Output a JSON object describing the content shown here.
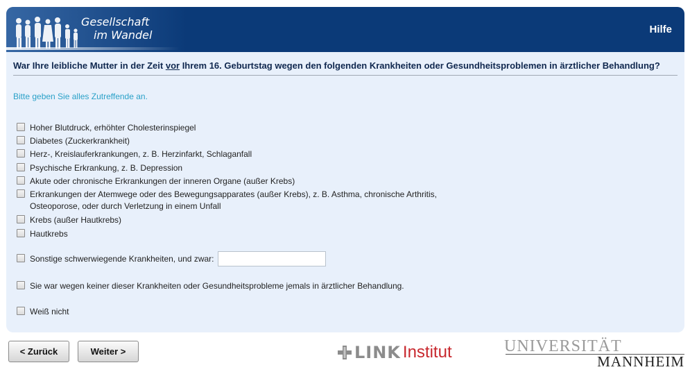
{
  "header": {
    "logo_line1": "Gesellschaft",
    "logo_line2": "im Wandel",
    "help_label": "Hilfe",
    "background_color": "#0b3a78"
  },
  "question": {
    "text_before": "War Ihre leibliche Mutter in der Zeit ",
    "text_underlined": "vor",
    "text_after": " Ihrem 16. Geburtstag wegen den folgenden Krankheiten oder Gesundheitsproblemen in ärztlicher Behandlung?",
    "instruction": "Bitte geben Sie alles Zutreffende an."
  },
  "options": [
    "Hoher Blutdruck, erhöhter Cholesterinspiegel",
    "Diabetes (Zuckerkrankheit)",
    "Herz-, Kreislauferkrankungen, z. B. Herzinfarkt, Schlaganfall",
    "Psychische Erkrankung, z. B. Depression",
    "Akute oder chronische Erkrankungen der inneren Organe (außer Krebs)",
    "Erkrankungen der Atemwege oder des Bewegungsapparates (außer Krebs), z. B. Asthma, chronische Arthritis, Osteoporose, oder durch Verletzung in einem Unfall",
    "Krebs (außer Hautkrebs)",
    "Hautkrebs"
  ],
  "other_option": {
    "label": "Sonstige schwerwiegende Krankheiten, und zwar:",
    "value": ""
  },
  "none_option": "Sie war wegen keiner dieser Krankheiten oder Gesundheitsprobleme jemals in ärztlicher Behandlung.",
  "dont_know_option": "Weiß nicht",
  "navigation": {
    "back_label": "< Zurück",
    "next_label": "Weiter >"
  },
  "sponsors": {
    "link_word": "LINK",
    "link_institut": "Institut",
    "uni_line1": "UNIVERSITÄT",
    "uni_line2": "MANNHEIM"
  },
  "colors": {
    "panel": "#e8f0fb",
    "instruction": "#2aa1c8",
    "link_red": "#c8282e"
  }
}
